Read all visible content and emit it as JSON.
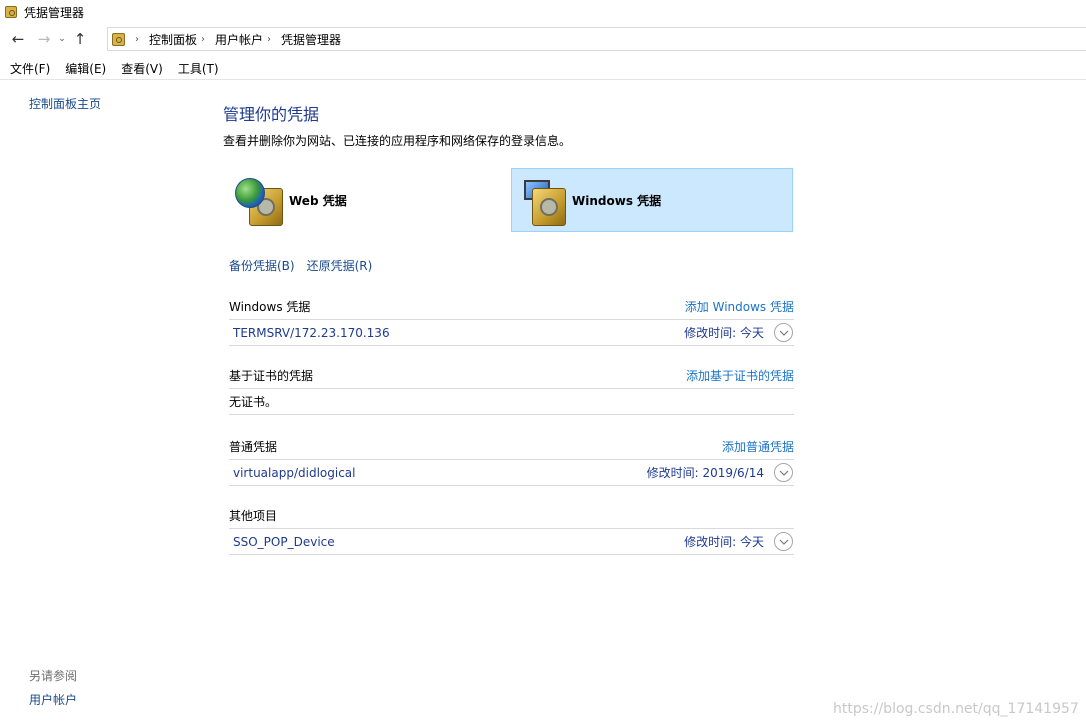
{
  "window": {
    "title": "凭据管理器",
    "icon": "credential-manager-icon"
  },
  "address": {
    "breadcrumbs": [
      "控制面板",
      "用户帐户",
      "凭据管理器"
    ],
    "back": "←",
    "forward": "→",
    "recent": "⌄",
    "up": "↑",
    "separator": "›"
  },
  "menu": [
    "文件(F)",
    "编辑(E)",
    "查看(V)",
    "工具(T)"
  ],
  "sidebar": {
    "home": "控制面板主页",
    "see_also_title": "另请参阅",
    "see_also_link": "用户帐户"
  },
  "main": {
    "title": "管理你的凭据",
    "description": "查看并删除你为网站、已连接的应用程序和网络保存的登录信息。",
    "tiles": {
      "web": "Web 凭据",
      "windows": "Windows 凭据",
      "selected": "windows"
    },
    "backup": "备份凭据(B)",
    "restore": "还原凭据(R)",
    "sections": [
      {
        "name": "Windows 凭据",
        "add": "添加 Windows 凭据",
        "item": "TERMSRV/172.23.170.136",
        "meta": "修改时间:  今天"
      },
      {
        "name": "基于证书的凭据",
        "add": "添加基于证书的凭据",
        "item": "无证书。",
        "meta": ""
      },
      {
        "name": "普通凭据",
        "add": "添加普通凭据",
        "item": "virtualapp/didlogical",
        "meta": "修改时间:  2019/6/14"
      },
      {
        "name": "其他项目",
        "add": "",
        "item": "SSO_POP_Device",
        "meta": "修改时间:  今天"
      }
    ]
  },
  "watermark": "https://blog.csdn.net/qq_17141957",
  "colors": {
    "link": "#1a4a8c",
    "title": "#1e3a8f",
    "selected_tile": "#cce8ff"
  }
}
